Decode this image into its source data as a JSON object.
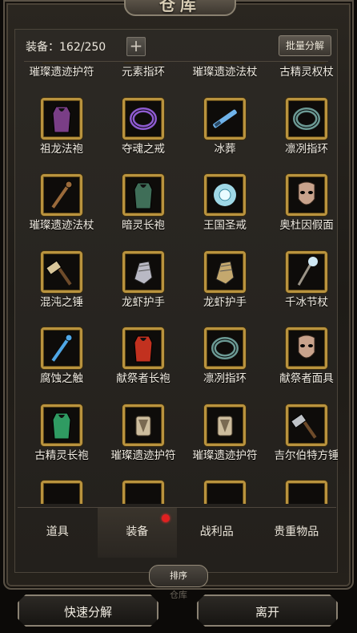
{
  "window": {
    "title": "仓库"
  },
  "header": {
    "equip_count": "装备：162/250",
    "add_symbol": "+",
    "batch_button": "批量分解"
  },
  "items": [
    {
      "name": "璀璨遗迹护符",
      "icon": "amulet-icon",
      "partial": true
    },
    {
      "name": "元素指环",
      "icon": "ring-icon",
      "partial": true
    },
    {
      "name": "璀璨遗迹法杖",
      "icon": "staff-icon",
      "partial": true
    },
    {
      "name": "古精灵权杖",
      "icon": "scepter-icon",
      "partial": true
    },
    {
      "name": "祖龙法袍",
      "icon": "robe-icon",
      "color": "#7a3e86"
    },
    {
      "name": "夺魂之戒",
      "icon": "ring-icon",
      "color": "#8e5bd0"
    },
    {
      "name": "冰葬",
      "icon": "sword-icon",
      "color": "#6fb3ea"
    },
    {
      "name": "凛冽指环",
      "icon": "ring-icon",
      "color": "#6c9a94"
    },
    {
      "name": "璀璨遗迹法杖",
      "icon": "staff-icon",
      "color": "#9a6a3a"
    },
    {
      "name": "暗灵长袍",
      "icon": "robe-icon",
      "color": "#3f6e58"
    },
    {
      "name": "王国圣戒",
      "icon": "holy-ring-icon",
      "color": "#9fd8e6"
    },
    {
      "name": "奥杜因假面",
      "icon": "mask-icon",
      "color": "#c9a38c"
    },
    {
      "name": "混沌之锤",
      "icon": "hammer-icon",
      "color": "#d8c69a"
    },
    {
      "name": "龙虾护手",
      "icon": "gauntlet-icon",
      "color": "#b9b9c4"
    },
    {
      "name": "龙虾护手",
      "icon": "gauntlet-icon",
      "color": "#c4a86e"
    },
    {
      "name": "千冰节杖",
      "icon": "scepter-icon",
      "color": "#cfe8f4"
    },
    {
      "name": "腐蚀之触",
      "icon": "staff-icon",
      "color": "#4fa7e6"
    },
    {
      "name": "献祭者长袍",
      "icon": "robe-icon",
      "color": "#c2311f"
    },
    {
      "name": "凛冽指环",
      "icon": "ring-icon",
      "color": "#6c9a94"
    },
    {
      "name": "献祭者面具",
      "icon": "mask-icon",
      "color": "#c9a38c"
    },
    {
      "name": "古精灵长袍",
      "icon": "robe-icon",
      "color": "#2f9b62"
    },
    {
      "name": "璀璨遗迹护符",
      "icon": "amulet-icon",
      "color": "#cdbd9e"
    },
    {
      "name": "璀璨遗迹护符",
      "icon": "amulet-icon",
      "color": "#cdbd9e"
    },
    {
      "name": "吉尔伯特方锤",
      "icon": "hammer-icon",
      "color": "#bfc3c8"
    }
  ],
  "tabs": [
    {
      "label": "道具",
      "active": false
    },
    {
      "label": "装备",
      "active": true,
      "badge": true
    },
    {
      "label": "战利品",
      "active": false
    },
    {
      "label": "贵重物品",
      "active": false
    }
  ],
  "sort_button": "排序",
  "footer_ghost": "仓库",
  "buttons": {
    "quick_decompose": "快速分解",
    "leave": "离开"
  },
  "colors": {
    "slot_border": "#b9933e",
    "badge": "#e02020"
  }
}
